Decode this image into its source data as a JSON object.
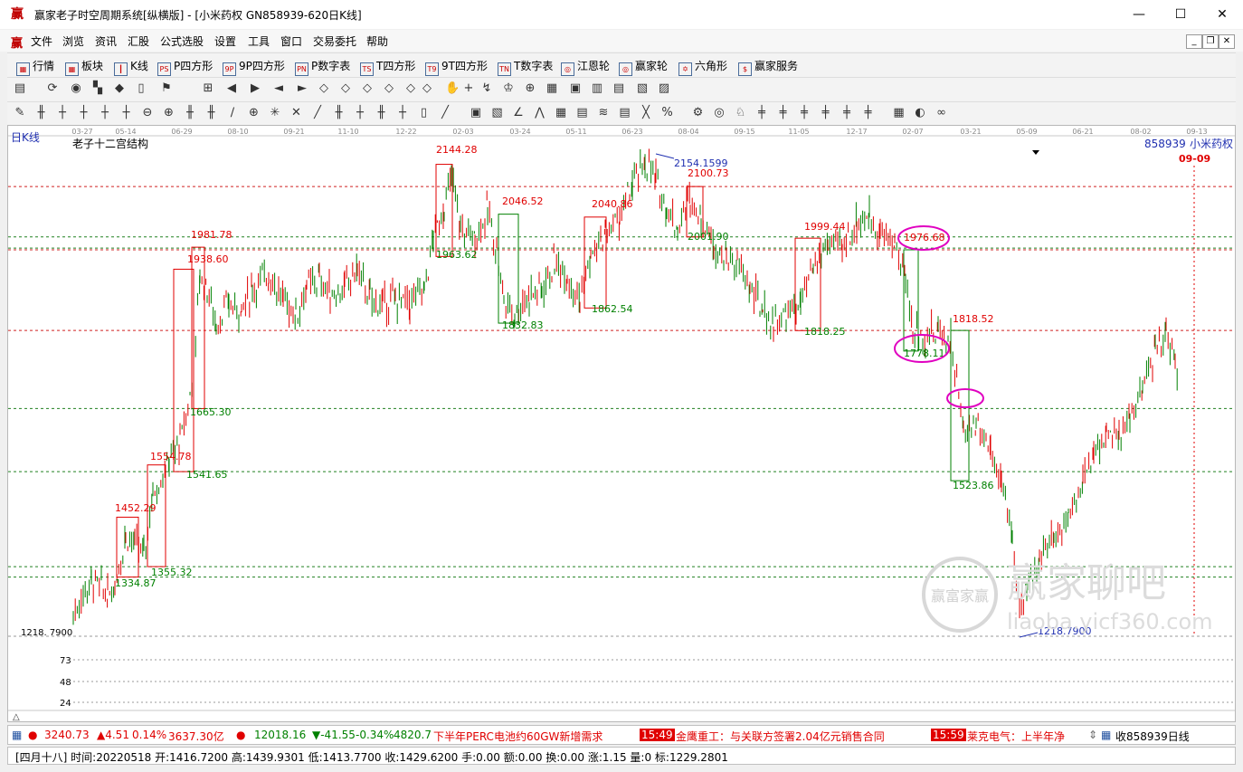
{
  "window": {
    "title": "赢家老子时空周期系统[纵横版] - [小米药权  GN858939-620日K线]",
    "logo": "赢"
  },
  "menu": [
    "文件",
    "浏览",
    "资讯",
    "汇股",
    "公式选股",
    "设置",
    "工具",
    "窗口",
    "交易委托",
    "帮助"
  ],
  "toolbar1": [
    {
      "label": "行情",
      "icon": "▦"
    },
    {
      "label": "板块",
      "icon": "▦"
    },
    {
      "label": "K线",
      "icon": "┃"
    },
    {
      "label": "P四方形",
      "icon": "PS"
    },
    {
      "label": "9P四方形",
      "icon": "9P"
    },
    {
      "label": "P数字表",
      "icon": "PN"
    },
    {
      "label": "T四方形",
      "icon": "TS"
    },
    {
      "label": "9T四方形",
      "icon": "T9"
    },
    {
      "label": "T数字表",
      "icon": "TN"
    },
    {
      "label": "江恩轮",
      "icon": "◎"
    },
    {
      "label": "赢家轮",
      "icon": "◎"
    },
    {
      "label": "六角形",
      "icon": "✡"
    },
    {
      "label": "赢家服务",
      "icon": "$"
    }
  ],
  "chart": {
    "period_label": "日K线",
    "indicator_label": "老子十二宫结构",
    "stock_code": "858939",
    "stock_name": "小米药权",
    "current_date": "09-09",
    "date_ticks": [
      "03-27",
      "05-14",
      "06-29",
      "08-10",
      "09-21",
      "11-10",
      "12-22",
      "02-03",
      "03-24",
      "05-11",
      "06-23",
      "08-04",
      "09-15",
      "11-05",
      "12-17",
      "02-07",
      "03-21",
      "05-09",
      "06-21",
      "08-02",
      "09-13"
    ],
    "y_axis": {
      "min_label": "1218. 7900",
      "sub_ticks": [
        "73",
        "48",
        "24"
      ]
    },
    "price_labels": [
      {
        "text": "2144.28",
        "color": "red"
      },
      {
        "text": "2154.1599",
        "color": "blue"
      },
      {
        "text": "2100.73",
        "color": "red"
      },
      {
        "text": "2046.52",
        "color": "red"
      },
      {
        "text": "2040.86",
        "color": "red"
      },
      {
        "text": "2001.90",
        "color": "green"
      },
      {
        "text": "1999.44",
        "color": "red"
      },
      {
        "text": "1981.78",
        "color": "red"
      },
      {
        "text": "1976.68",
        "color": "red"
      },
      {
        "text": "1963.62",
        "color": "green"
      },
      {
        "text": "1938.60",
        "color": "red"
      },
      {
        "text": "1832.83",
        "color": "green"
      },
      {
        "text": "1862.54",
        "color": "green"
      },
      {
        "text": "1818.52",
        "color": "red"
      },
      {
        "text": "1818.25",
        "color": "green"
      },
      {
        "text": "1778.11",
        "color": "green"
      },
      {
        "text": "1665.30",
        "color": "green"
      },
      {
        "text": "1554.78",
        "color": "red"
      },
      {
        "text": "1541.65",
        "color": "green"
      },
      {
        "text": "1523.86",
        "color": "green"
      },
      {
        "text": "1452.29",
        "color": "red"
      },
      {
        "text": "1355.32",
        "color": "green"
      },
      {
        "text": "1334.87",
        "color": "green"
      },
      {
        "text": "1218.7900",
        "color": "blue"
      }
    ],
    "watermark": {
      "text": "赢家聊吧",
      "url": "liaoba.yicf360.com",
      "seal": "赢富家赢"
    }
  },
  "status1": {
    "sh_value": "3240.73",
    "sh_change": "▲4.51",
    "sh_pct": "0.14%",
    "sh_amount": "3637.30亿",
    "sz_value": "12018.16",
    "sz_change": "▼-41.55",
    "sz_pct": "-0.34%",
    "sz_amount": "4820.7",
    "news1": "下半年PERC电池约60GW新增需求",
    "time1": "15:49",
    "news2": "金鹰重工：与关联方签署2.04亿元销售合同",
    "time2": "15:59",
    "news3": "莱克电气：上半年净",
    "right": "收858939日线"
  },
  "status2": {
    "text": "[四月十八] 时间:20220518 开:1416.7200 高:1439.9301 低:1413.7700 收:1429.6200 手:0.00 额:0.00 换:0.00 涨:1.15 量:0 标:1229.2801"
  }
}
